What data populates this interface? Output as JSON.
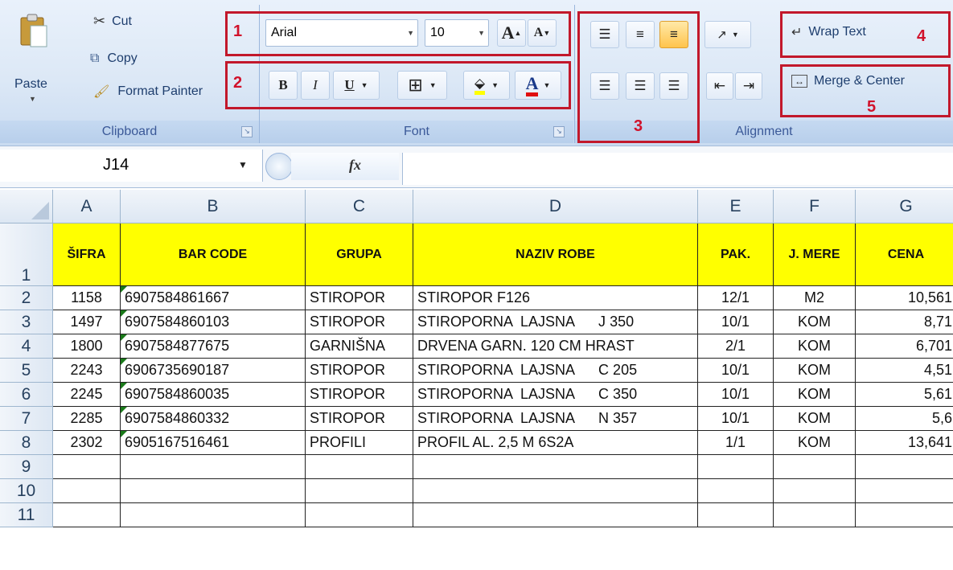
{
  "clipboard": {
    "paste_label": "Paste",
    "cut_label": "Cut",
    "copy_label": "Copy",
    "format_painter_label": "Format Painter",
    "group_label": "Clipboard"
  },
  "font": {
    "font_name": "Arial",
    "font_size": "10",
    "grow_label": "A",
    "shrink_label": "A",
    "bold_label": "B",
    "italic_label": "I",
    "underline_label": "U",
    "font_color_label": "A",
    "group_label": "Font"
  },
  "alignment": {
    "wrap_text_label": "Wrap Text",
    "merge_center_label": "Merge & Center",
    "group_label": "Alignment"
  },
  "annotations": [
    "1",
    "2",
    "3",
    "4",
    "5"
  ],
  "formula_bar": {
    "name_box": "J14",
    "fx_label": "fx",
    "formula": ""
  },
  "sheet": {
    "columns": [
      "A",
      "B",
      "C",
      "D",
      "E",
      "F",
      "G"
    ],
    "row_numbers": [
      "1",
      "2",
      "3",
      "4",
      "5",
      "6",
      "7",
      "8",
      "9",
      "10",
      "11"
    ],
    "header": [
      "ŠIFRA",
      "BAR CODE",
      "GRUPA",
      "NAZIV ROBE",
      "PAK.",
      "J. MERE",
      "CENA"
    ],
    "rows": [
      [
        "1158",
        "6907584861667",
        "STIROPOR",
        "STIROPOR F126",
        "12/1",
        "M2",
        "10,561"
      ],
      [
        "1497",
        "6907584860103",
        "STIROPOR",
        "STIROPORNA  LAJSNA      J 350",
        "10/1",
        "KOM",
        "8,71"
      ],
      [
        "1800",
        "6907584877675",
        "GARNIŠNA",
        "DRVENA GARN. 120 CM HRAST",
        "2/1",
        "KOM",
        "6,701"
      ],
      [
        "2243",
        "6906735690187",
        "STIROPOR",
        "STIROPORNA  LAJSNA      C 205",
        "10/1",
        "KOM",
        "4,51"
      ],
      [
        "2245",
        "6907584860035",
        "STIROPOR",
        "STIROPORNA  LAJSNA      C 350",
        "10/1",
        "KOM",
        "5,61"
      ],
      [
        "2285",
        "6907584860332",
        "STIROPOR",
        "STIROPORNA  LAJSNA      N 357",
        "10/1",
        "KOM",
        "5,6"
      ],
      [
        "2302",
        "6905167516461",
        "PROFILI",
        "PROFIL AL. 2,5 M 6S2A",
        "1/1",
        "KOM",
        "13,641"
      ],
      [
        "",
        "",
        "",
        "",
        "",
        "",
        ""
      ],
      [
        "",
        "",
        "",
        "",
        "",
        "",
        ""
      ],
      [
        "",
        "",
        "",
        "",
        "",
        "",
        ""
      ]
    ]
  },
  "colors": {
    "header_fill": "#ffff00",
    "annotation_red": "#c2182b",
    "ribbon_blue": "#dce8f6"
  }
}
